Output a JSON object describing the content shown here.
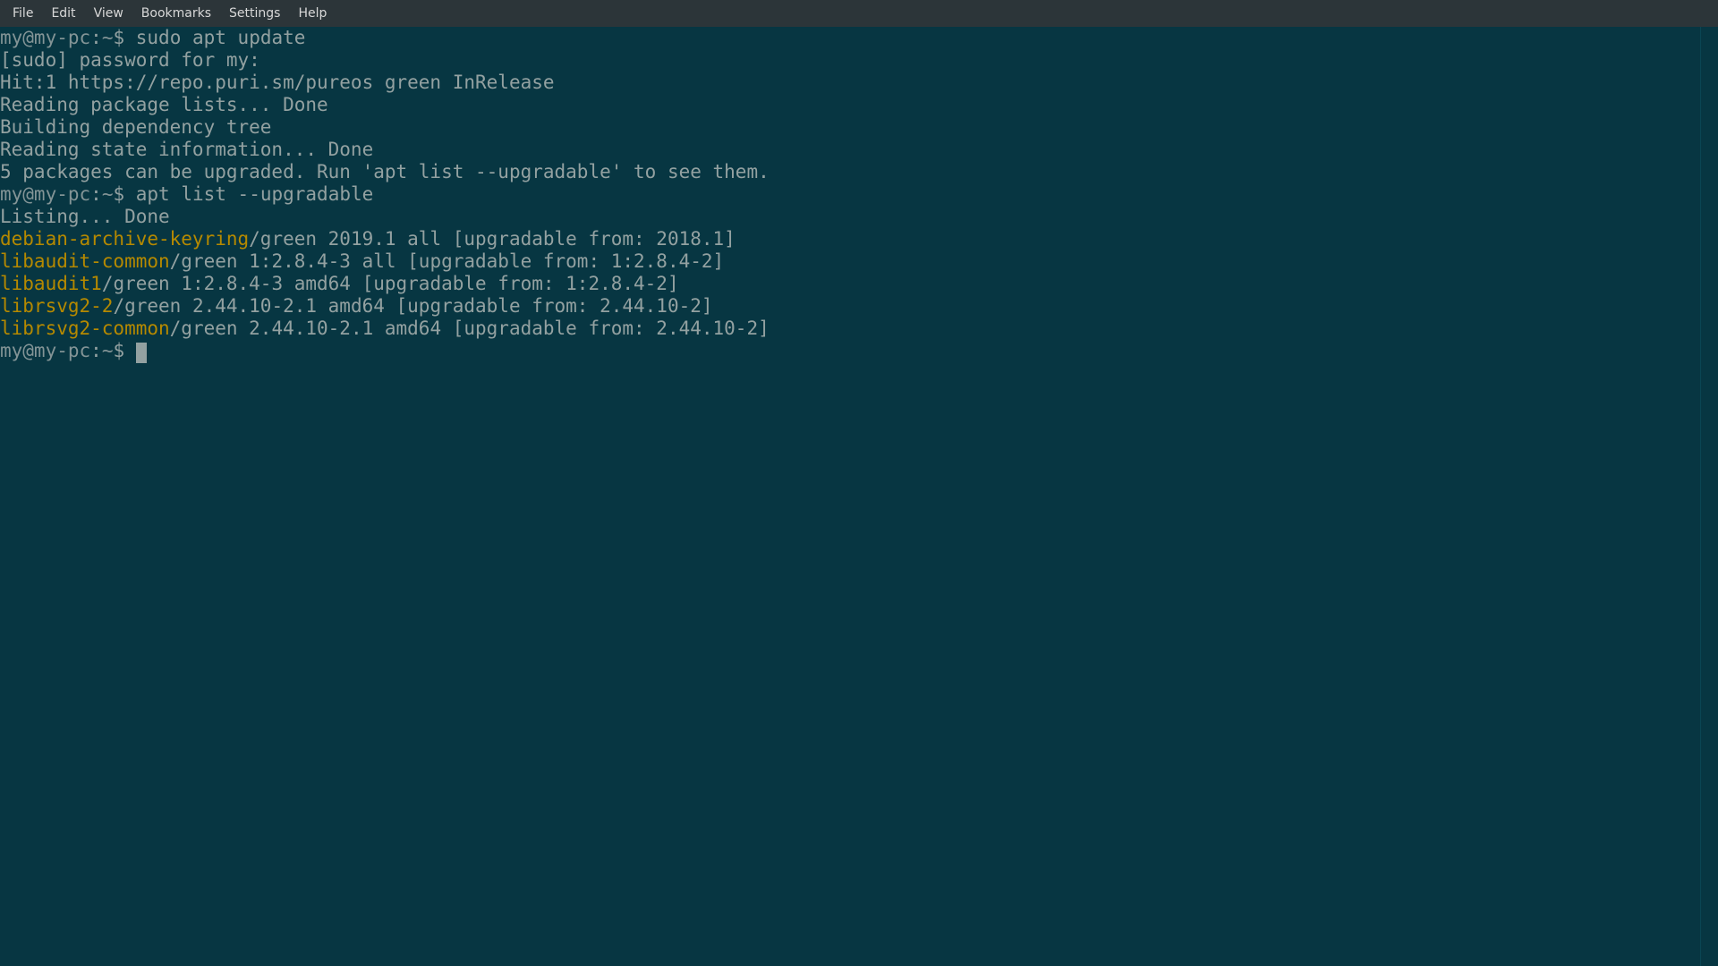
{
  "menubar": {
    "items": [
      "File",
      "Edit",
      "View",
      "Bookmarks",
      "Settings",
      "Help"
    ]
  },
  "prompt": {
    "user_host": "my@my-pc",
    "sep": ":",
    "path": "~",
    "sigil": "$"
  },
  "lines": [
    {
      "type": "prompt",
      "cmd": "sudo apt update"
    },
    {
      "type": "out",
      "text": "[sudo] password for my: "
    },
    {
      "type": "out",
      "text": "Hit:1 https://repo.puri.sm/pureos green InRelease"
    },
    {
      "type": "out",
      "text": "Reading package lists... Done"
    },
    {
      "type": "out",
      "text": "Building dependency tree       "
    },
    {
      "type": "out",
      "text": "Reading state information... Done"
    },
    {
      "type": "out",
      "text": "5 packages can be upgraded. Run 'apt list --upgradable' to see them."
    },
    {
      "type": "prompt",
      "cmd": "apt list --upgradable"
    },
    {
      "type": "out",
      "text": "Listing... Done"
    },
    {
      "type": "pkg",
      "name": "debian-archive-keyring",
      "rest": "/green 2019.1 all [upgradable from: 2018.1]"
    },
    {
      "type": "pkg",
      "name": "libaudit-common",
      "rest": "/green 1:2.8.4-3 all [upgradable from: 1:2.8.4-2]"
    },
    {
      "type": "pkg",
      "name": "libaudit1",
      "rest": "/green 1:2.8.4-3 amd64 [upgradable from: 1:2.8.4-2]"
    },
    {
      "type": "pkg",
      "name": "librsvg2-2",
      "rest": "/green 2.44.10-2.1 amd64 [upgradable from: 2.44.10-2]"
    },
    {
      "type": "pkg",
      "name": "librsvg2-common",
      "rest": "/green 2.44.10-2.1 amd64 [upgradable from: 2.44.10-2]"
    },
    {
      "type": "prompt",
      "cmd": "",
      "cursor": true
    }
  ]
}
